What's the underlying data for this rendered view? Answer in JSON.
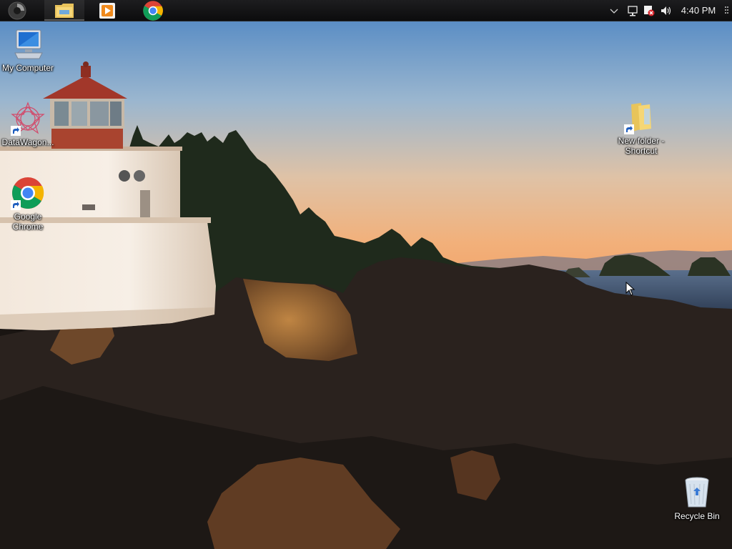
{
  "taskbar": {
    "start_icon": "start-orb-icon",
    "pinned": [
      {
        "name": "file-explorer",
        "icon": "folder-icon",
        "active": true
      },
      {
        "name": "media-player",
        "icon": "play-icon",
        "active": false
      },
      {
        "name": "google-chrome",
        "icon": "chrome-icon",
        "active": false
      }
    ],
    "tray": {
      "overflow_icon": "chevron-down-icon",
      "network_icon": "network-icon",
      "security_icon": "security-flag-icon",
      "volume_icon": "speaker-icon",
      "clock": "4:40 PM",
      "show_desktop_icon": "grip-icon"
    }
  },
  "desktop": {
    "icons": [
      {
        "id": "my-computer",
        "label": "My Computer",
        "icon": "computer-icon",
        "shortcut": false
      },
      {
        "id": "datawagon",
        "label": "DataWagon...",
        "icon": "datawagon-icon",
        "shortcut": true
      },
      {
        "id": "google-chrome",
        "label": "Google Chrome",
        "icon": "chrome-icon",
        "shortcut": true
      },
      {
        "id": "new-folder-shortcut",
        "label": "New folder - Shortcut",
        "icon": "folder-icon",
        "shortcut": true
      },
      {
        "id": "recycle-bin",
        "label": "Recycle Bin",
        "icon": "recycle-bin-icon",
        "shortcut": false
      }
    ]
  },
  "colors": {
    "taskbar": "#121213",
    "sky_top": "#4f86c4",
    "sky_bottom": "#f0b27a",
    "rocks": "#2a2320"
  }
}
